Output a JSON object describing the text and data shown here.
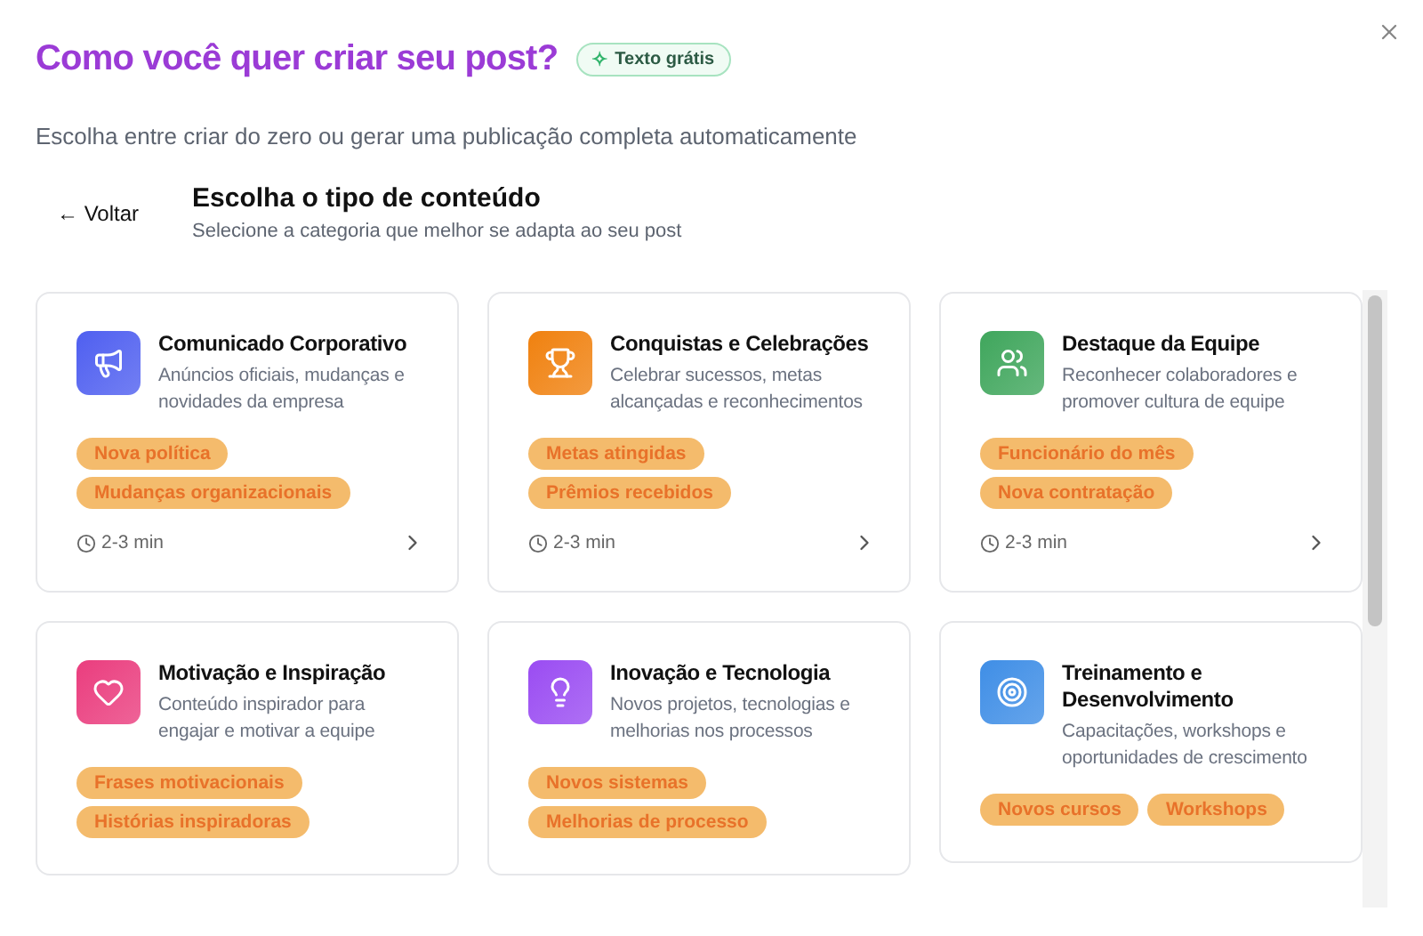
{
  "title": "Como você quer criar seu post?",
  "badge": {
    "icon": "✧",
    "label": "Texto grátis"
  },
  "subtitle": "Escolha entre criar do zero ou gerar uma publicação completa automaticamente",
  "back": "← Voltar",
  "section": {
    "title": "Escolha o tipo de conteúdo",
    "subtitle": "Selecione a categoria que melhor se adapta ao seu post"
  },
  "cards": [
    {
      "kind": "megaphone",
      "color": "#4f5ff0",
      "title": "Comunicado Corporativo",
      "description": "Anúncios oficiais, mudanças e novidades da empresa",
      "tags": [
        "Nova política",
        "Mudanças organizacionais"
      ],
      "time": "2-3 min"
    },
    {
      "kind": "trophy",
      "color": "#f0810f",
      "title": "Conquistas e Celebrações",
      "description": "Celebrar sucessos, metas alcançadas e reconhecimentos",
      "tags": [
        "Metas atingidas",
        "Prêmios recebidos"
      ],
      "time": "2-3 min"
    },
    {
      "kind": "users",
      "color": "#3fa65c",
      "title": "Destaque da Equipe",
      "description": "Reconhecer colaboradores e promover cultura de equipe",
      "tags": [
        "Funcionário do mês",
        "Nova contratação"
      ],
      "time": "2-3 min"
    },
    {
      "kind": "heart",
      "color": "#ea3d7e",
      "title": "Motivação e Inspiração",
      "description": "Conteúdo inspirador para engajar e motivar a equipe",
      "tags": [
        "Frases motivacionais",
        "Histórias inspiradoras"
      ]
    },
    {
      "kind": "bulb",
      "color": "#9a4cf2",
      "title": "Inovação e Tecnologia",
      "description": "Novos projetos, tecnologias e melhorias nos processos",
      "tags": [
        "Novos sistemas",
        "Melhorias de processo"
      ]
    },
    {
      "kind": "target",
      "color": "#3f8ee6",
      "title": "Treinamento e Desenvolvimento",
      "description": "Capacitações, workshops e oportunidades de crescimento",
      "tags": [
        "Novos cursos",
        "Workshops"
      ]
    }
  ]
}
